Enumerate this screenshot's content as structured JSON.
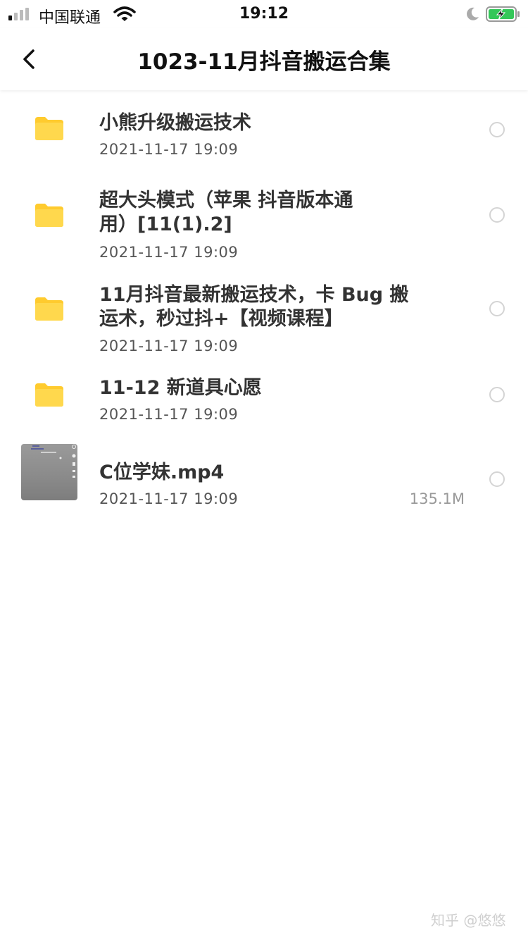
{
  "status_bar": {
    "carrier": "中国联通",
    "time": "19:12",
    "icons": [
      "signal-icon",
      "wifi-icon",
      "moon-icon",
      "battery-charging-icon"
    ]
  },
  "nav": {
    "title": "1023-11月抖音搬运合集",
    "back_icon": "chevron-left-icon"
  },
  "items": [
    {
      "type": "folder",
      "icon": "folder-icon",
      "name_lines": [
        "小熊升级搬运技术"
      ],
      "date": "2021-11-17 19:09",
      "size": ""
    },
    {
      "type": "folder",
      "icon": "folder-icon",
      "name_lines": [
        "超大头模式（苹果 抖音版本通",
        "用）[11(1).2]"
      ],
      "date": "2021-11-17 19:09",
      "size": ""
    },
    {
      "type": "folder",
      "icon": "folder-icon",
      "name_lines": [
        "11月抖音最新搬运技术，卡 Bug 搬",
        "运术，秒过抖+【视频课程】"
      ],
      "date": "2021-11-17 19:09",
      "size": ""
    },
    {
      "type": "folder",
      "icon": "folder-icon",
      "name_lines": [
        "11-12 新道具心愿"
      ],
      "date": "2021-11-17 19:09",
      "size": ""
    },
    {
      "type": "video",
      "icon": "video-thumbnail",
      "name_lines": [
        "C位学妹.mp4"
      ],
      "date": "2021-11-17 19:09",
      "size": "135.1M"
    }
  ],
  "watermark": "知乎 @悠悠",
  "colors": {
    "folder": "#FFD84D",
    "folder_tab": "#FFCB2E",
    "battery": "#34C759",
    "radio_border": "#D4D4D4"
  }
}
